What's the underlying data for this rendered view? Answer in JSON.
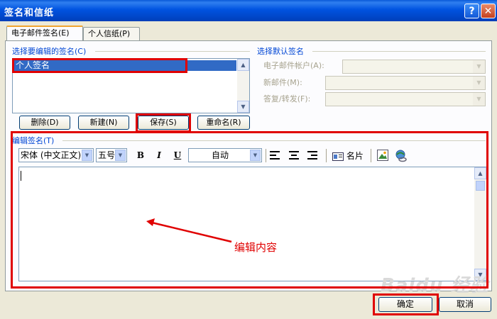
{
  "window": {
    "title": "签名和信纸",
    "help": "?",
    "close": "✕"
  },
  "tabs": [
    {
      "label": "电子邮件签名(E)"
    },
    {
      "label": "个人信纸(P)"
    }
  ],
  "left_group": {
    "title": "选择要编辑的签名(C)",
    "items": [
      "个人签名"
    ],
    "buttons": {
      "delete": "删除(D)",
      "new": "新建(N)",
      "save": "保存(S)",
      "rename": "重命名(R)"
    }
  },
  "right_group": {
    "title": "选择默认签名",
    "account_label": "电子邮件帐户(A):",
    "new_mail_label": "新邮件(M):",
    "reply_label": "答复/转发(F):"
  },
  "editor": {
    "title": "编辑签名(T)",
    "font": "宋体 (中文正文)",
    "size": "五号",
    "bold": "B",
    "italic": "I",
    "underline": "U",
    "color": "自动",
    "card": "名片"
  },
  "annotation": "编辑内容",
  "footer": {
    "ok": "确定",
    "cancel": "取消"
  },
  "watermark": "Baidu 经验",
  "colors": {
    "highlight": "#e00000",
    "selection": "#316ac5"
  }
}
